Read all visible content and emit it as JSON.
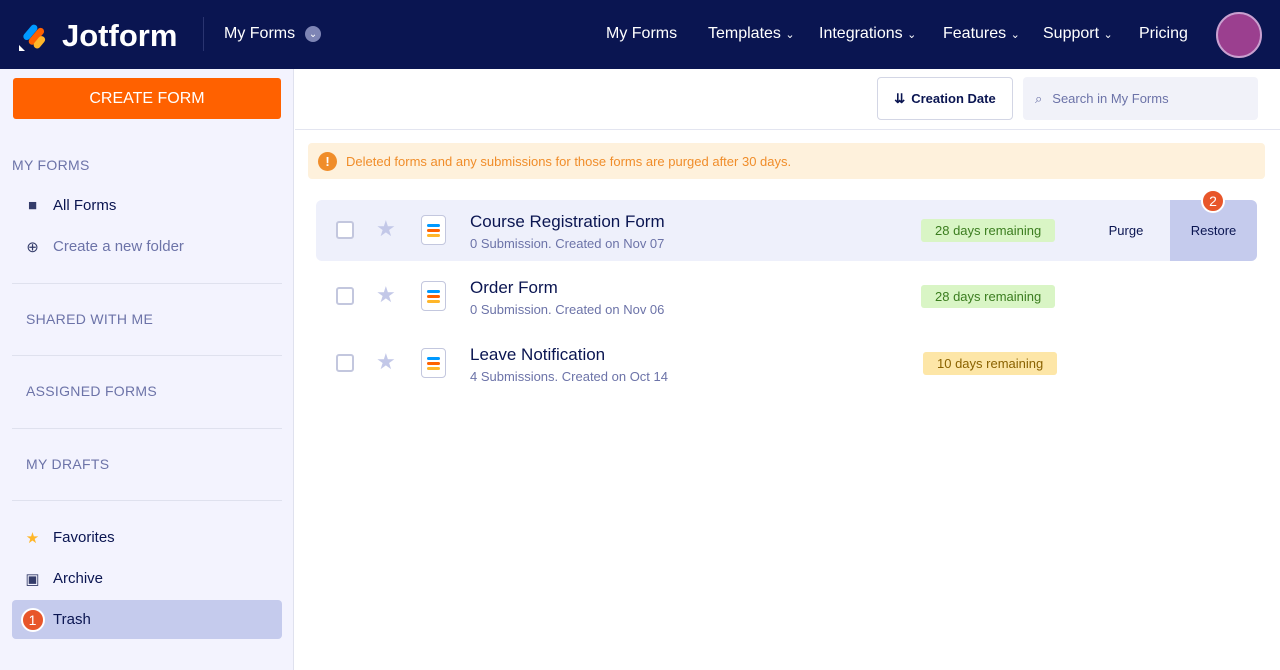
{
  "header": {
    "logo": "Jotform",
    "my_forms": "My Forms",
    "nav": [
      "My Forms",
      "Templates",
      "Integrations",
      "Features",
      "Support",
      "Pricing"
    ]
  },
  "sidebar": {
    "create": "CREATE FORM",
    "my_forms": "MY FORMS",
    "all_forms": "All Forms",
    "new_folder": "Create a new folder",
    "shared": "SHARED WITH ME",
    "assigned": "ASSIGNED FORMS",
    "drafts": "MY DRAFTS",
    "favorites": "Favorites",
    "archive": "Archive",
    "trash": "Trash",
    "badge": "1"
  },
  "toolbar": {
    "sort": "Creation Date",
    "search_placeholder": "Search in My Forms"
  },
  "warning": "Deleted forms and any submissions for those forms are purged after 30 days.",
  "forms": [
    {
      "title": "Course Registration Form",
      "sub": "0 Submission. Created on Nov 07",
      "remaining": "28 days remaining"
    },
    {
      "title": "Order Form",
      "sub": "0 Submission. Created on Nov 06",
      "remaining": "28 days remaining"
    },
    {
      "title": "Leave Notification",
      "sub": "4 Submissions. Created on Oct 14",
      "remaining": "10 days remaining"
    }
  ],
  "actions": {
    "purge": "Purge",
    "restore": "Restore",
    "badge": "2"
  }
}
